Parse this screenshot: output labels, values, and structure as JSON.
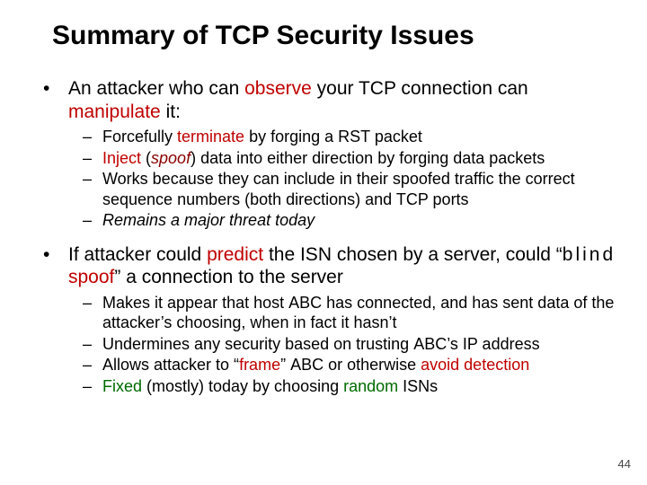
{
  "title": "Summary of TCP Security Issues",
  "b1": {
    "lead": "An attacker who can ",
    "observe": "observe",
    "mid": " your TCP connection can ",
    "manip": "manipulate",
    "tail": " it:"
  },
  "b1s": [
    {
      "pre": "Forcefully ",
      "term": "terminate",
      "post": " by forging a RST packet"
    },
    {
      "inj": "Inject",
      "paren1": " (",
      "spoof": "spoof",
      "paren2": ") data into either direction by forging data packets"
    },
    {
      "txt": "Works because they can include in their spoofed traffic the correct sequence numbers (both directions) and TCP ports"
    },
    {
      "rem": "Remains a major threat today"
    }
  ],
  "b2": {
    "a": "If attacker could ",
    "predict": "predict",
    "b": " the ISN chosen by a server, could ",
    "q1": "“",
    "blind": "blind ",
    "spoof": "spoof",
    "q2": "”",
    "c": " a connection to the server"
  },
  "b2s": [
    {
      "a": "Makes it appear that host ",
      "abc": "ABC",
      "b": " has connected, and has sent data of the attacker’s choosing, when in fact it hasn’t"
    },
    {
      "a": "Undermines any security based on trusting ",
      "abc": "ABC",
      "b": "’s IP address"
    },
    {
      "a": "Allows attacker to “",
      "frame": "frame",
      "b": "” ",
      "abc": "ABC",
      "c": " or otherwise ",
      "avoid": "avoid detection"
    },
    {
      "fixed": "Fixed",
      "a": " (mostly) today by choosing ",
      "random": "random",
      "b": " ISNs"
    }
  ],
  "page": "44"
}
